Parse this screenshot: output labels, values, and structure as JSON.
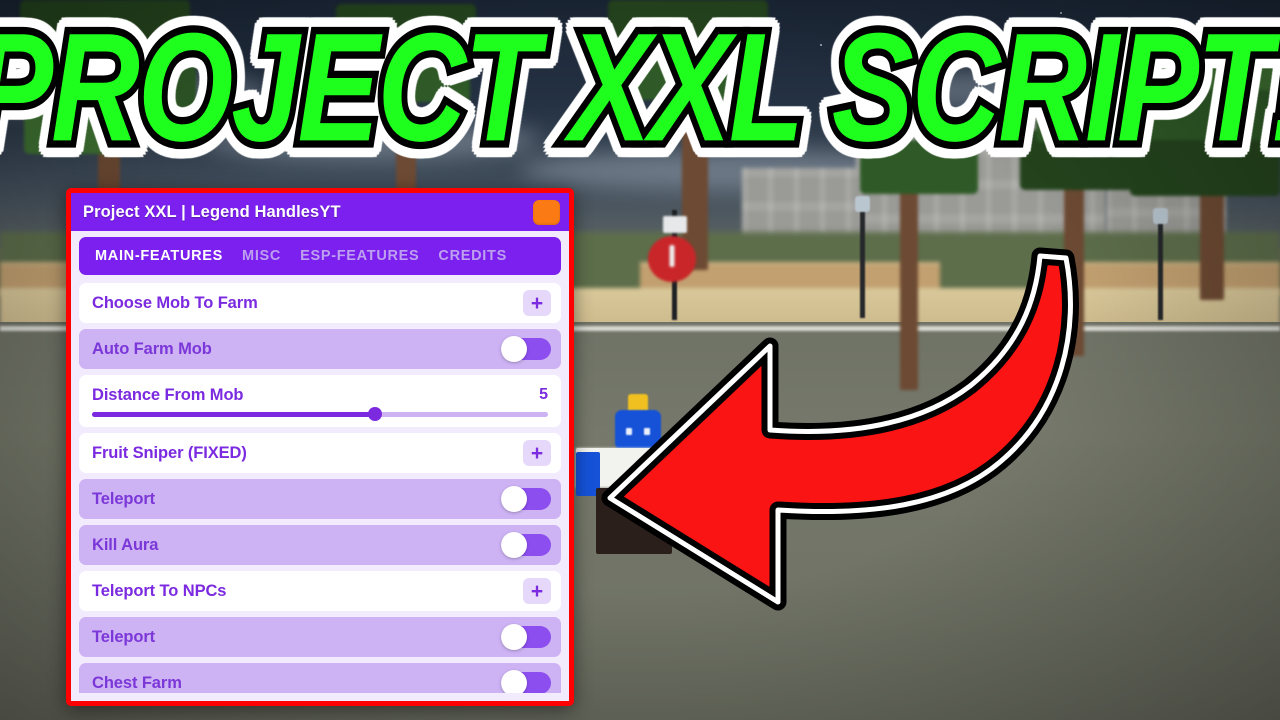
{
  "banner": {
    "text": "PROJECT XXL SCRIPT!",
    "text_color": "#1eff1e",
    "outline_color": "#000000",
    "glow_color": "#ffffff"
  },
  "arrow": {
    "name": "red-curved-arrow",
    "direction": "left",
    "fill_color": "#fb1414",
    "outline_color": "#000000",
    "highlight_color": "#ffffff"
  },
  "panel": {
    "border_color": "#fe0000",
    "header": {
      "title": "Project XXL | Legend HandlesYT",
      "background": "#7b20ef",
      "close_button_color": "#fb7a14"
    },
    "tabs": [
      {
        "label": "MAIN-FEATURES",
        "active": true
      },
      {
        "label": "MISC",
        "active": false
      },
      {
        "label": "ESP-FEATURES",
        "active": false
      },
      {
        "label": "CREDITS",
        "active": false
      }
    ],
    "rows": [
      {
        "label": "Choose Mob To Farm",
        "type": "dropdown",
        "style": "white",
        "control": "+"
      },
      {
        "label": "Auto Farm Mob",
        "type": "toggle",
        "style": "tinted",
        "state": "off"
      },
      {
        "label": "Distance From Mob",
        "type": "slider",
        "style": "white",
        "value": "5",
        "fill_percent": 62
      },
      {
        "label": "Fruit Sniper (FIXED)",
        "type": "dropdown",
        "style": "white",
        "control": "+"
      },
      {
        "label": "Teleport",
        "type": "toggle",
        "style": "tinted",
        "state": "off"
      },
      {
        "label": "Kill Aura",
        "type": "toggle",
        "style": "tinted",
        "state": "off"
      },
      {
        "label": "Teleport To NPCs",
        "type": "dropdown",
        "style": "white",
        "control": "+"
      },
      {
        "label": "Teleport",
        "type": "toggle",
        "style": "tinted",
        "state": "off"
      },
      {
        "label": "Chest Farm",
        "type": "toggle",
        "style": "tinted",
        "state": "off"
      }
    ]
  },
  "scene": {
    "description": "Blocky low-poly city street at dusk",
    "sky_color": "#253243",
    "road_color": "#6f7266",
    "sidewalk_color": "#d9c89a",
    "tree_color": "#2f5a27",
    "npc_shirt_color": "#1552d8",
    "npc_hair_color": "#efc01f"
  }
}
